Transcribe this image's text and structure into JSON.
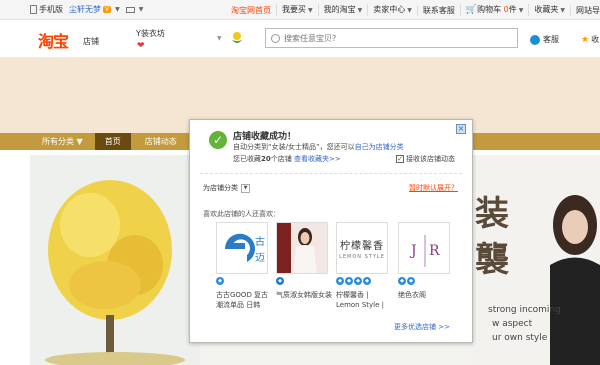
{
  "site_nav": {
    "mobile": "手机版",
    "user": "尘轩无梦",
    "home": "淘宝网首页",
    "buy": "我要买",
    "my_taobao": "我的淘宝",
    "seller": "卖家中心",
    "support": "联系客服",
    "cart": "购物车",
    "cart_count": "0",
    "cart_unit": "件",
    "favorites": "收藏夹",
    "sitenav": "网站导"
  },
  "header": {
    "logo": "淘宝",
    "logo_sub": "店铺",
    "shop_name": "Y装衣坊",
    "search_placeholder": "搜索任意宝贝?",
    "service": "客服",
    "fav": "收"
  },
  "shop_nav": {
    "all_categories": "所有分类 ▼",
    "home": "首页",
    "activity": "店铺动态"
  },
  "ad": {
    "big1": "装",
    "big2": "襲",
    "line1": "strong incoming",
    "line2": "w aspect",
    "line3": "ur own style"
  },
  "modal": {
    "title": "店铺收藏成功！",
    "line1_prefix": "自动分类到",
    "line1_category": "“女装/女士精品”",
    "line1_mid": "，您还可以",
    "line1_link": "自己为店铺分类",
    "line2_prefix": "您已收藏",
    "line2_count": "20",
    "line2_suffix": "个店铺",
    "line2_link": "查看收藏夹>>",
    "receive": "接收该店铺动态",
    "category_label": "为店铺分类",
    "category_toggle": "暂时默认展开？",
    "liked_title": "喜欢此店铺的人还喜欢：",
    "more": "更多优选店铺 >>",
    "items": [
      {
        "name": "古古GOOD 复古潮流单品 日韩",
        "badges": 1,
        "logo_text": "古 迈"
      },
      {
        "name": "气质淑女韩版女装",
        "badges": 1,
        "logo_text": ""
      },
      {
        "name": "柠檬馨香 | Lemon Style |",
        "badges": 4,
        "logo_text": "柠檬馨香",
        "logo_sub": "LEMON STYLE"
      },
      {
        "name": "绝色衣阁",
        "badges": 2,
        "logo_text": "J R"
      }
    ]
  }
}
